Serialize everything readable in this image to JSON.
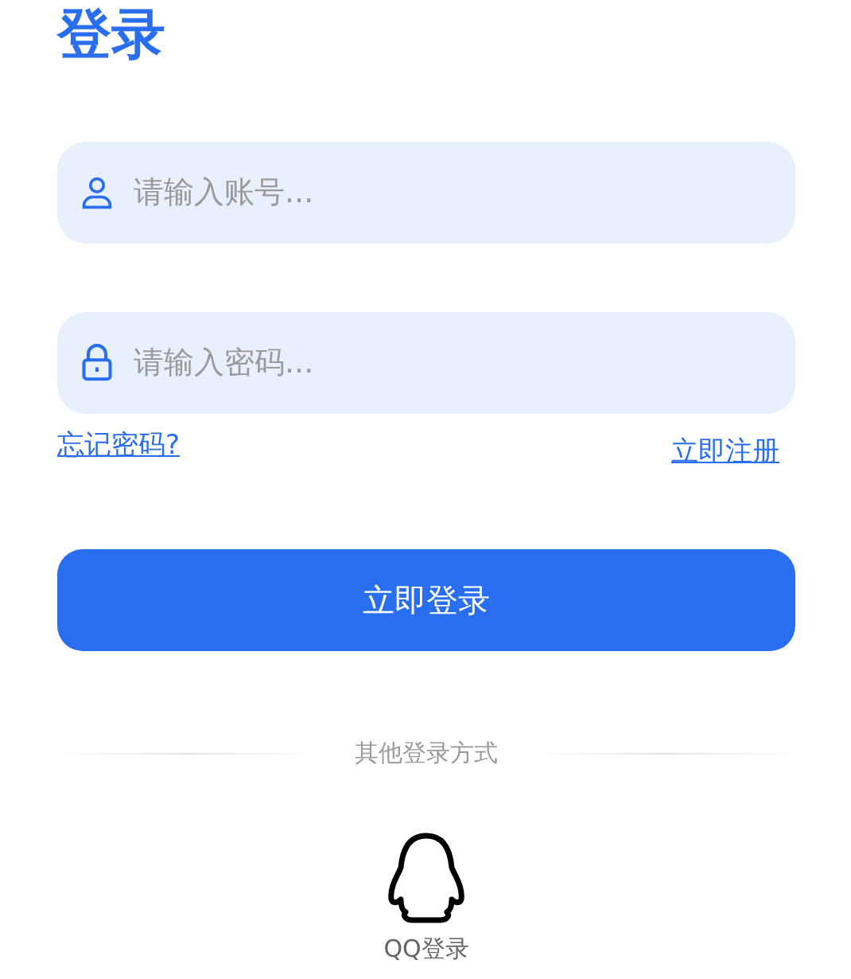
{
  "title": "登录",
  "fields": [
    {
      "kind": "user",
      "placeholder": "请输入账号..."
    },
    {
      "kind": "lock",
      "placeholder": "请输入密码..."
    }
  ],
  "links": {
    "forgot": "忘记密码?",
    "register": "立即注册"
  },
  "submit": "立即登录",
  "divider": "其他登录方式",
  "social": [
    {
      "kind": "qq",
      "label": "QQ登录"
    }
  ]
}
